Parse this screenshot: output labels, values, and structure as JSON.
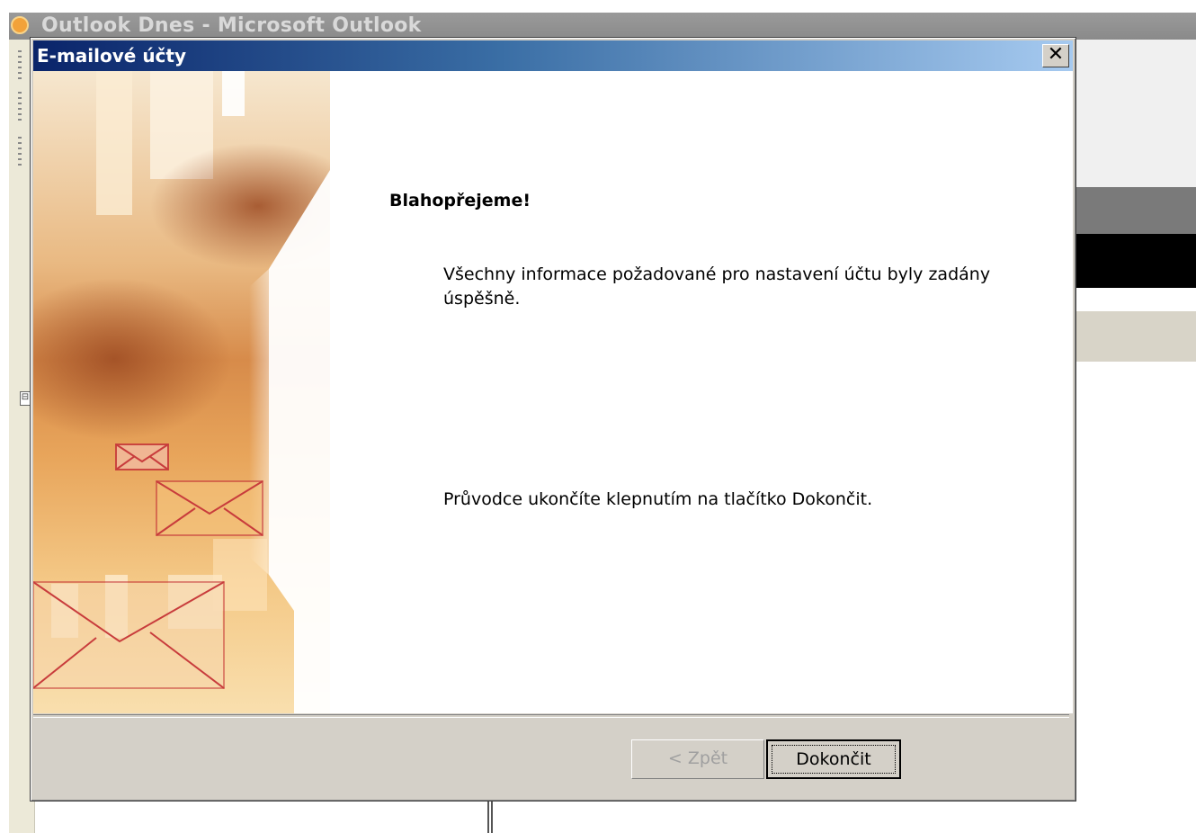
{
  "background_window": {
    "title": "Outlook Dnes - Microsoft Outlook",
    "left_marker": "⊟"
  },
  "dialog": {
    "title": "E-mailové účty",
    "close_glyph": "✕",
    "heading": "Blahopřejeme!",
    "message_1": "Všechny informace požadované pro nastavení účtu byly zadány úspěšně.",
    "message_2": "Průvodce ukončíte klepnutím na tlačítko Dokončit.",
    "buttons": {
      "back": "< Zpět",
      "finish": "Dokončit"
    }
  },
  "icons": [
    "app-clock-icon",
    "close-icon",
    "envelope-icon"
  ],
  "colors": {
    "titlebar_start": "#0a246a",
    "titlebar_end": "#a6caf0",
    "dialog_face": "#d4d0c8",
    "art_orange": "#d78b4a",
    "envelope_stroke": "#c83c3c"
  }
}
